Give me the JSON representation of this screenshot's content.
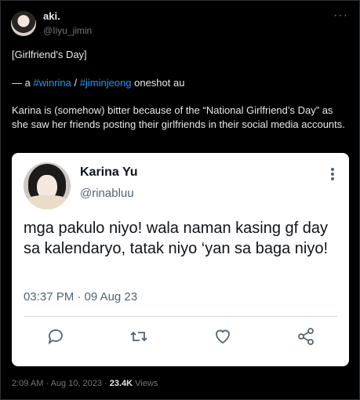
{
  "post": {
    "display_name": "aki.",
    "handle": "@Iiyu_jimin",
    "more": "···",
    "line1": "[Girlfriend's Day]",
    "line2_prefix": "— a ",
    "tag1": "#winrina",
    "slash": " / ",
    "tag2": "#jiminjeong",
    "line2_suffix": " oneshot au",
    "body": "Karina is (somehow) bitter because of the “National Girlfriend’s Day” as she saw her friends posting their girlfriends in their social media accounts."
  },
  "quote": {
    "name": "Karina Yu",
    "handle": "@rinabluu",
    "text": "mga pakulo niyo! wala naman kasing gf day sa kalendaryo, tatak niyo ‘yan sa baga niyo!",
    "time": "03:37 PM · 09 Aug 23",
    "icons": [
      "reply-icon",
      "retweet-icon",
      "like-icon",
      "share-icon"
    ]
  },
  "footer": {
    "time": "2:09 AM · Aug 10, 2023 · ",
    "views_count": "23.4K",
    "views_label": " Views"
  },
  "colors": {
    "link": "#1d9bf0",
    "bg": "#000000",
    "card": "#ffffff"
  }
}
